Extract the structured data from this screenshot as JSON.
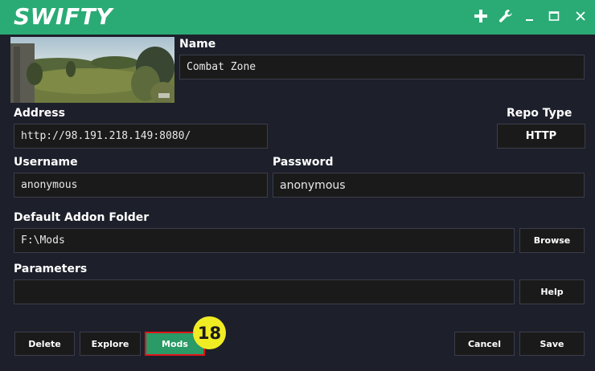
{
  "app": {
    "title": "SWIFTY",
    "toolbar_icons": [
      "plus-icon",
      "wrench-icon",
      "minimize-icon",
      "maximize-icon",
      "close-icon"
    ]
  },
  "colors": {
    "titlebar": "#2aab75",
    "background": "#1d202b",
    "field_bg": "#1a1a1a",
    "mods_button": "#2a9a66",
    "highlight_border": "#e0161a",
    "badge": "#f0ec24"
  },
  "form": {
    "name_label": "Name",
    "name_value": "Combat Zone",
    "address_label": "Address",
    "address_value": "http://98.191.218.149:8080/",
    "repo_type_label": "Repo Type",
    "repo_type_value": "HTTP",
    "username_label": "Username",
    "username_value": "anonymous",
    "password_label": "Password",
    "password_value": "anonymous",
    "addon_folder_label": "Default Addon Folder",
    "addon_folder_value": "F:\\Mods",
    "browse_label": "Browse",
    "parameters_label": "Parameters",
    "parameters_value": "",
    "help_label": "Help"
  },
  "actions": {
    "delete": "Delete",
    "explore": "Explore",
    "mods": "Mods",
    "cancel": "Cancel",
    "save": "Save"
  },
  "annotation": {
    "step_number": "18"
  }
}
